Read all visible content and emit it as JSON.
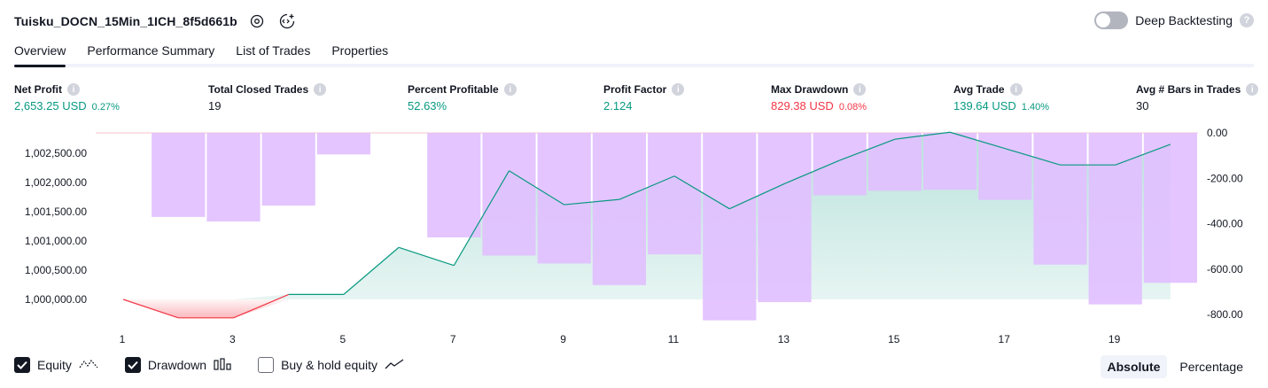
{
  "header": {
    "strategy_name": "Tuisku_DOCN_15Min_1ICH_8f5d661b",
    "deep_backtesting_label": "Deep Backtesting",
    "deep_backtesting_enabled": false
  },
  "tabs": [
    {
      "label": "Overview",
      "active": true
    },
    {
      "label": "Performance Summary",
      "active": false
    },
    {
      "label": "List of Trades",
      "active": false
    },
    {
      "label": "Properties",
      "active": false
    }
  ],
  "metrics": {
    "net_profit": {
      "label": "Net Profit",
      "value": "2,653.25 USD",
      "pct": "0.27%"
    },
    "total_closed_trades": {
      "label": "Total Closed Trades",
      "value": "19"
    },
    "percent_profitable": {
      "label": "Percent Profitable",
      "value": "52.63%"
    },
    "profit_factor": {
      "label": "Profit Factor",
      "value": "2.124"
    },
    "max_drawdown": {
      "label": "Max Drawdown",
      "value": "829.38 USD",
      "pct": "0.08%"
    },
    "avg_trade": {
      "label": "Avg Trade",
      "value": "139.64 USD",
      "pct": "1.40%"
    },
    "avg_bars": {
      "label": "Avg # Bars in Trades",
      "value": "30"
    }
  },
  "chart_data": {
    "type": "line",
    "x": [
      1,
      2,
      3,
      4,
      5,
      6,
      7,
      8,
      9,
      10,
      11,
      12,
      13,
      14,
      15,
      16,
      17,
      18,
      19,
      20
    ],
    "x_ticks": [
      "1",
      "3",
      "5",
      "7",
      "9",
      "11",
      "13",
      "15",
      "17",
      "19"
    ],
    "left_axis_ticks": [
      "1,000,000.00",
      "1,000,500.00",
      "1,001,000.00",
      "1,001,500.00",
      "1,002,000.00",
      "1,002,500.00"
    ],
    "right_axis_ticks": [
      "0.00",
      "-200.00",
      "-400.00",
      "-600.00",
      "-800.00"
    ],
    "ylim_equity": [
      999630,
      1002830
    ],
    "ylim_drawdown": [
      -900,
      0
    ],
    "series": [
      {
        "name": "Equity",
        "color": "#089981",
        "values": [
          1000000,
          999685,
          999685,
          1000085,
          1000085,
          1000890,
          1000580,
          1002200,
          1001620,
          1001710,
          1002110,
          1001550,
          1001980,
          1002380,
          1002740,
          1002860,
          1002580,
          1002300,
          1002300,
          1002653
        ]
      },
      {
        "name": "Drawdown",
        "color": "#e1bfff",
        "values": [
          0,
          -370,
          -390,
          -320,
          -95,
          0,
          -460,
          -540,
          -575,
          -670,
          -535,
          -825,
          -745,
          -275,
          -255,
          -250,
          -295,
          -580,
          -755,
          -660
        ]
      }
    ]
  },
  "legend": [
    {
      "label": "Equity",
      "checked": true,
      "icon": "equity-line-icon"
    },
    {
      "label": "Drawdown",
      "checked": true,
      "icon": "drawdown-bars-icon"
    },
    {
      "label": "Buy & hold equity",
      "checked": false,
      "icon": "buy-hold-line-icon"
    }
  ],
  "mode": {
    "absolute": "Absolute",
    "percentage": "Percentage",
    "selected": "Absolute"
  },
  "colors": {
    "profit": "#089981",
    "loss": "#f23645",
    "drawdown": "#e1bfff",
    "text": "#131722"
  }
}
